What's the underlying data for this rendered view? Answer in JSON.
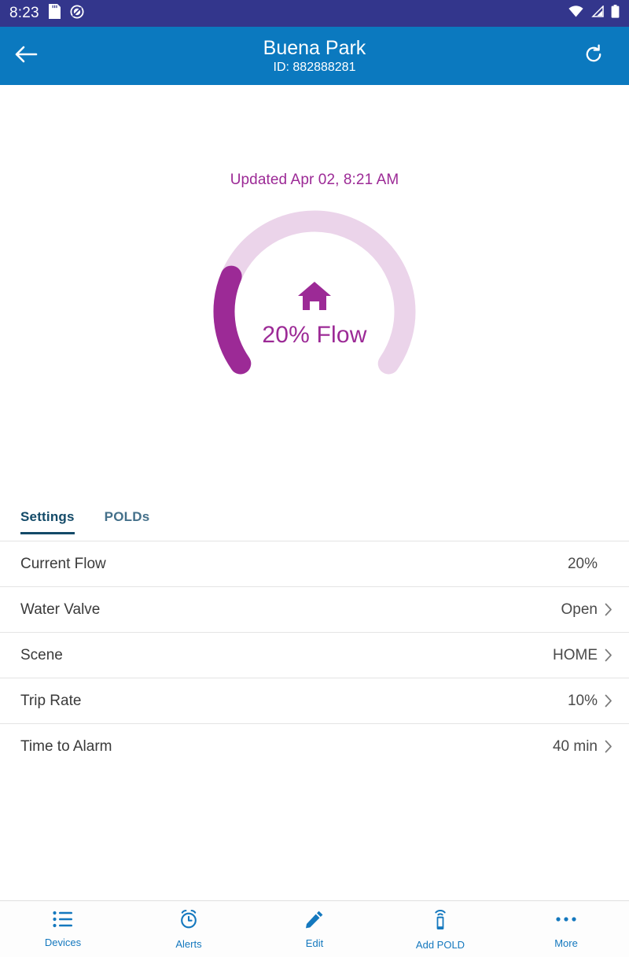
{
  "status_bar": {
    "time": "8:23",
    "icons_left": [
      "sd-card-icon",
      "do-not-disturb-icon"
    ],
    "icons_right": [
      "wifi-icon",
      "cellular-signal-icon",
      "battery-icon"
    ]
  },
  "app_bar": {
    "back_icon": "arrow-left-icon",
    "title": "Buena Park",
    "subtitle": "ID: 882888281",
    "refresh_icon": "refresh-icon",
    "background_color": "#0B79BF"
  },
  "gauge": {
    "updated_text": "Updated Apr 02, 8:21 AM",
    "center_icon": "home-icon",
    "value_label": "20% Flow",
    "percent": 20,
    "fill_color": "#9C2A96",
    "track_color": "#EBD4EA"
  },
  "tabs": [
    {
      "label": "Settings",
      "active": true
    },
    {
      "label": "POLDs",
      "active": false
    }
  ],
  "settings_rows": [
    {
      "label": "Current Flow",
      "value": "20%",
      "chevron": false
    },
    {
      "label": "Water Valve",
      "value": "Open",
      "chevron": true
    },
    {
      "label": "Scene",
      "value": "HOME",
      "chevron": true
    },
    {
      "label": "Trip Rate",
      "value": "10%",
      "chevron": true
    },
    {
      "label": "Time to Alarm",
      "value": "40 min",
      "chevron": true
    }
  ],
  "bottom_nav": [
    {
      "label": "Devices",
      "icon": "list-icon"
    },
    {
      "label": "Alerts",
      "icon": "alarm-clock-icon"
    },
    {
      "label": "Edit",
      "icon": "pencil-icon"
    },
    {
      "label": "Add POLD",
      "icon": "device-signal-icon"
    },
    {
      "label": "More",
      "icon": "ellipsis-icon"
    }
  ],
  "accent_color": "#1478BE"
}
